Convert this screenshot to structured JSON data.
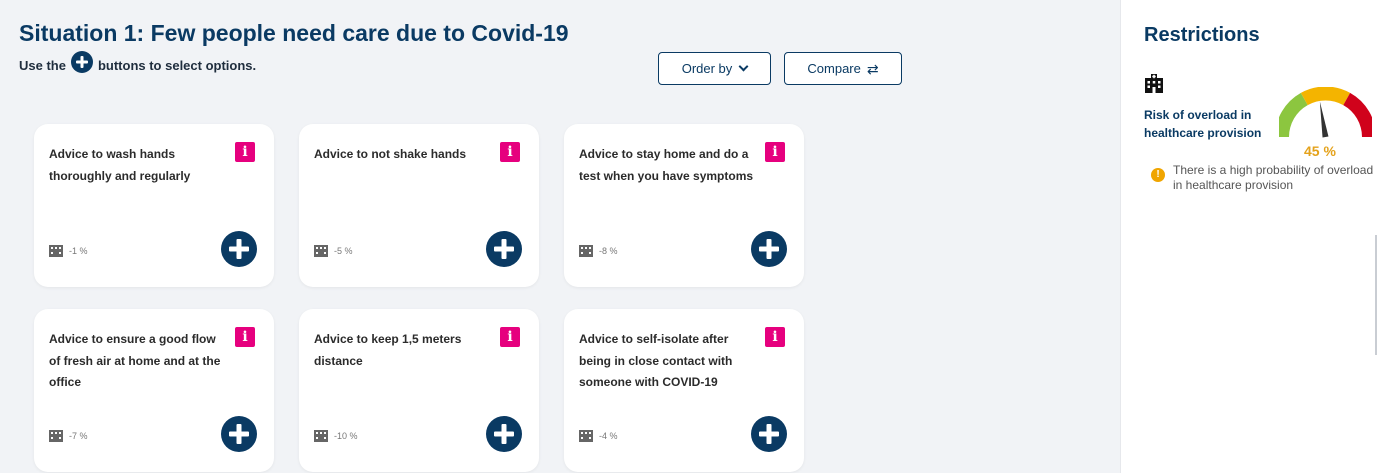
{
  "page": {
    "title": "Situation 1: Few people need care due to Covid-19",
    "hint_before": "Use the",
    "hint_after": "buttons to select options."
  },
  "toolbar": {
    "order_by_label": "Order by",
    "compare_label": "Compare"
  },
  "cards": [
    {
      "title": "Advice to wash hands thoroughly and regularly",
      "impact": "-1 %"
    },
    {
      "title": "Advice to not shake hands",
      "impact": "-5 %"
    },
    {
      "title": "Advice to stay home and do a test when you have symptoms",
      "impact": "-8 %"
    },
    {
      "title": "Advice to ensure a good flow of fresh air at home and at the office",
      "impact": "-7 %"
    },
    {
      "title": "Advice to keep 1,5 meters distance",
      "impact": "-10 %"
    },
    {
      "title": "Advice to self-isolate after being in close contact with someone with COVID-19",
      "impact": "-4 %"
    }
  ],
  "card_info_glyph": "i",
  "sidebar": {
    "title": "Restrictions",
    "risk_label": "Risk of overload in healthcare provision",
    "gauge_value_text": "45 %",
    "gauge_level_fraction": 0.45,
    "warning_glyph": "!",
    "warning_text": "There is a high probability of overload in healthcare provision"
  },
  "colors": {
    "brand_navy": "#0a3a63",
    "info_pink": "#e6007e",
    "gauge_green": "#8cc63f",
    "gauge_yellow": "#f4b400",
    "gauge_red": "#d0021b",
    "warning_amber": "#f0a500"
  },
  "icons": {
    "add": "plus-circle-icon",
    "info": "info-icon",
    "hospital": "hospital-icon",
    "order": "chevron-down-icon",
    "compare": "swap-arrows-icon",
    "warning": "warning-icon"
  }
}
